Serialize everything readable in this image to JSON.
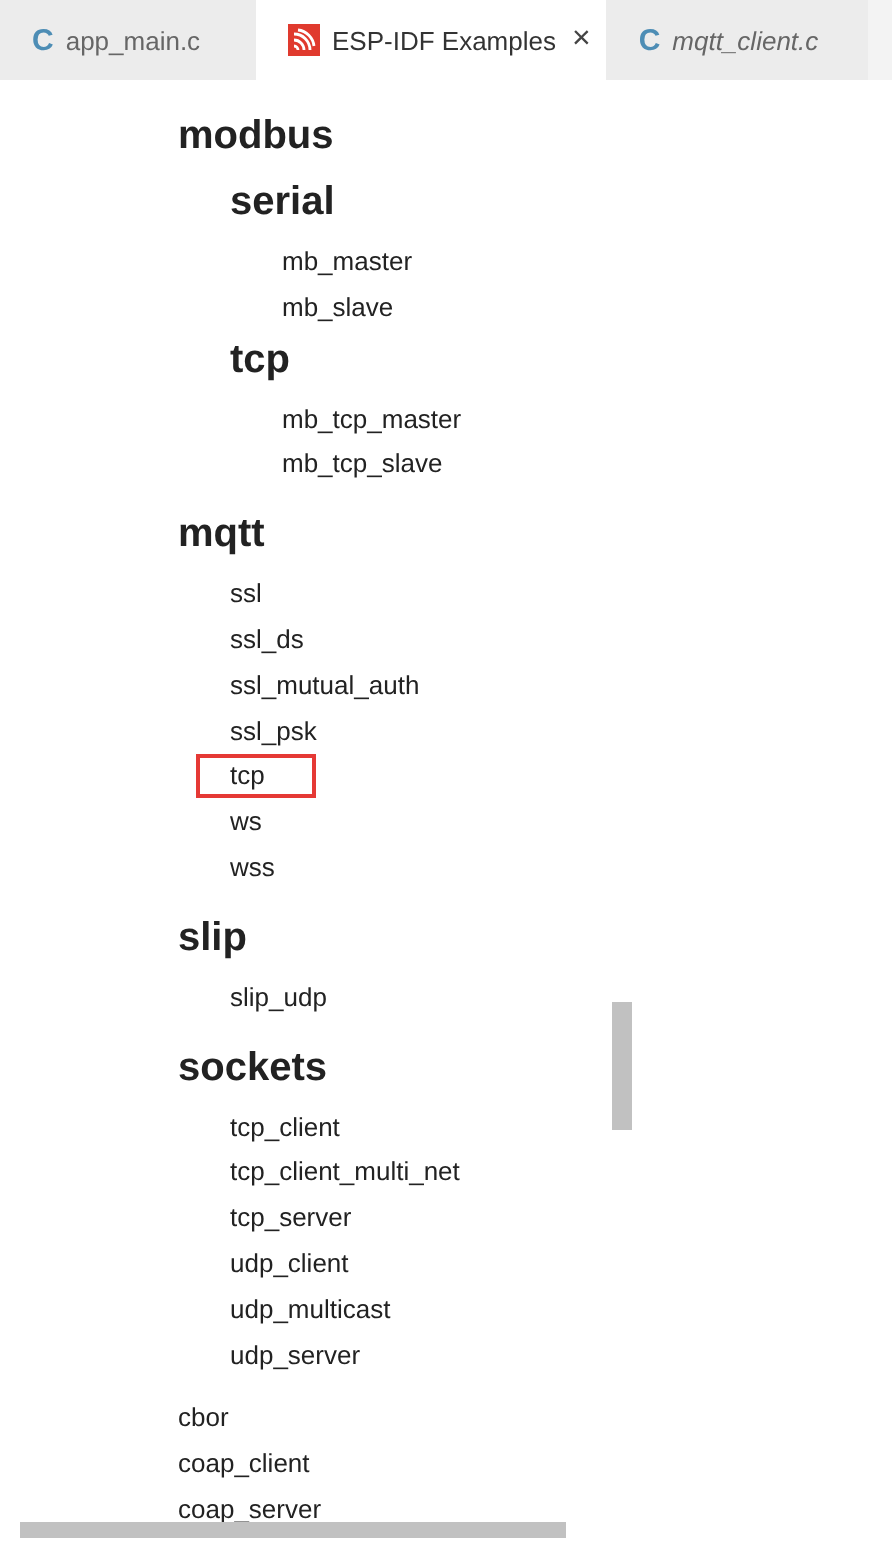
{
  "tabs": [
    {
      "kind": "c-file",
      "icon": "C",
      "label": "app_main.c",
      "selected": false,
      "preview": false
    },
    {
      "kind": "webview",
      "label": "ESP-IDF Examples",
      "selected": true,
      "preview": false,
      "close": "×"
    },
    {
      "kind": "c-file",
      "icon": "C",
      "label": "mqtt_client.c",
      "selected": false,
      "preview": true
    }
  ],
  "tree": [
    {
      "kind": "group",
      "label": "modbus",
      "children": [
        {
          "kind": "group",
          "label": "serial",
          "children": [
            {
              "kind": "leaf",
              "label": "mb_master",
              "outlined": false
            },
            {
              "kind": "leaf",
              "label": "mb_slave",
              "outlined": false
            }
          ]
        },
        {
          "kind": "group",
          "label": "tcp",
          "children": [
            {
              "kind": "leaf",
              "label": "mb_tcp_master",
              "outlined": false
            },
            {
              "kind": "leaf",
              "label": "mb_tcp_slave",
              "outlined": false
            }
          ]
        }
      ]
    },
    {
      "kind": "group",
      "label": "mqtt",
      "children": [
        {
          "kind": "leaf",
          "label": "ssl",
          "outlined": false
        },
        {
          "kind": "leaf",
          "label": "ssl_ds",
          "outlined": false
        },
        {
          "kind": "leaf",
          "label": "ssl_mutual_auth",
          "outlined": false
        },
        {
          "kind": "leaf",
          "label": "ssl_psk",
          "outlined": false
        },
        {
          "kind": "leaf",
          "label": "tcp",
          "outlined": true
        },
        {
          "kind": "leaf",
          "label": "ws",
          "outlined": false
        },
        {
          "kind": "leaf",
          "label": "wss",
          "outlined": false
        }
      ]
    },
    {
      "kind": "group",
      "label": "slip",
      "children": [
        {
          "kind": "leaf",
          "label": "slip_udp",
          "outlined": false
        }
      ]
    },
    {
      "kind": "group",
      "label": "sockets",
      "children": [
        {
          "kind": "leaf",
          "label": "tcp_client",
          "outlined": false
        },
        {
          "kind": "leaf",
          "label": "tcp_client_multi_net",
          "outlined": false
        },
        {
          "kind": "leaf",
          "label": "tcp_server",
          "outlined": false
        },
        {
          "kind": "leaf",
          "label": "udp_client",
          "outlined": false
        },
        {
          "kind": "leaf",
          "label": "udp_multicast",
          "outlined": false
        },
        {
          "kind": "leaf",
          "label": "udp_server",
          "outlined": false
        }
      ]
    },
    {
      "kind": "leaf",
      "label": "cbor",
      "outlined": false
    },
    {
      "kind": "leaf",
      "label": "coap_client",
      "outlined": false
    },
    {
      "kind": "leaf",
      "label": "coap_server",
      "outlined": false
    }
  ]
}
